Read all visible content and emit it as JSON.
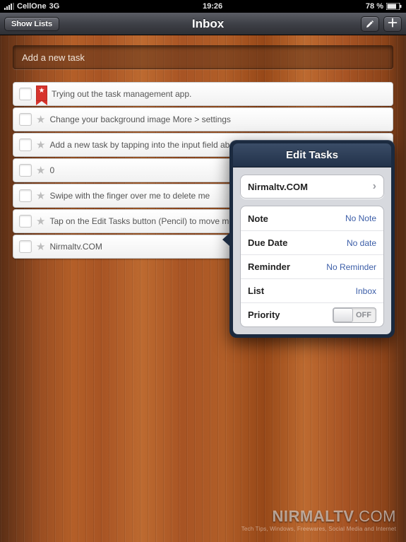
{
  "statusbar": {
    "carrier": "CellOne",
    "network": "3G",
    "time": "19:26",
    "battery_text": "78 %"
  },
  "navbar": {
    "show_lists_label": "Show Lists",
    "title": "Inbox"
  },
  "new_task_placeholder": "Add a new task",
  "tasks": [
    {
      "title": "Trying out the task management app.",
      "priority": true
    },
    {
      "title": "Change your background image More > settings",
      "priority": false
    },
    {
      "title": "Add a new task by tapping into the input field above",
      "priority": false
    },
    {
      "title": "0",
      "priority": false
    },
    {
      "title": "Swipe with the finger over me to delete me",
      "priority": false
    },
    {
      "title": "Tap on the Edit Tasks button (Pencil) to move me",
      "priority": false
    },
    {
      "title": "Nirmaltv.COM",
      "priority": false
    }
  ],
  "popover": {
    "header": "Edit Tasks",
    "task_title": "Nirmaltv.COM",
    "rows": {
      "note": {
        "label": "Note",
        "value": "No Note"
      },
      "due": {
        "label": "Due Date",
        "value": "No date"
      },
      "reminder": {
        "label": "Reminder",
        "value": "No Reminder"
      },
      "list": {
        "label": "List",
        "value": "Inbox"
      },
      "priority": {
        "label": "Priority",
        "value": "OFF"
      }
    }
  },
  "watermark": {
    "line1a": "NIRMALTV",
    "line1b": ".COM",
    "line2": "Tech Tips, Windows, Freewares, Social Media and Internet"
  }
}
